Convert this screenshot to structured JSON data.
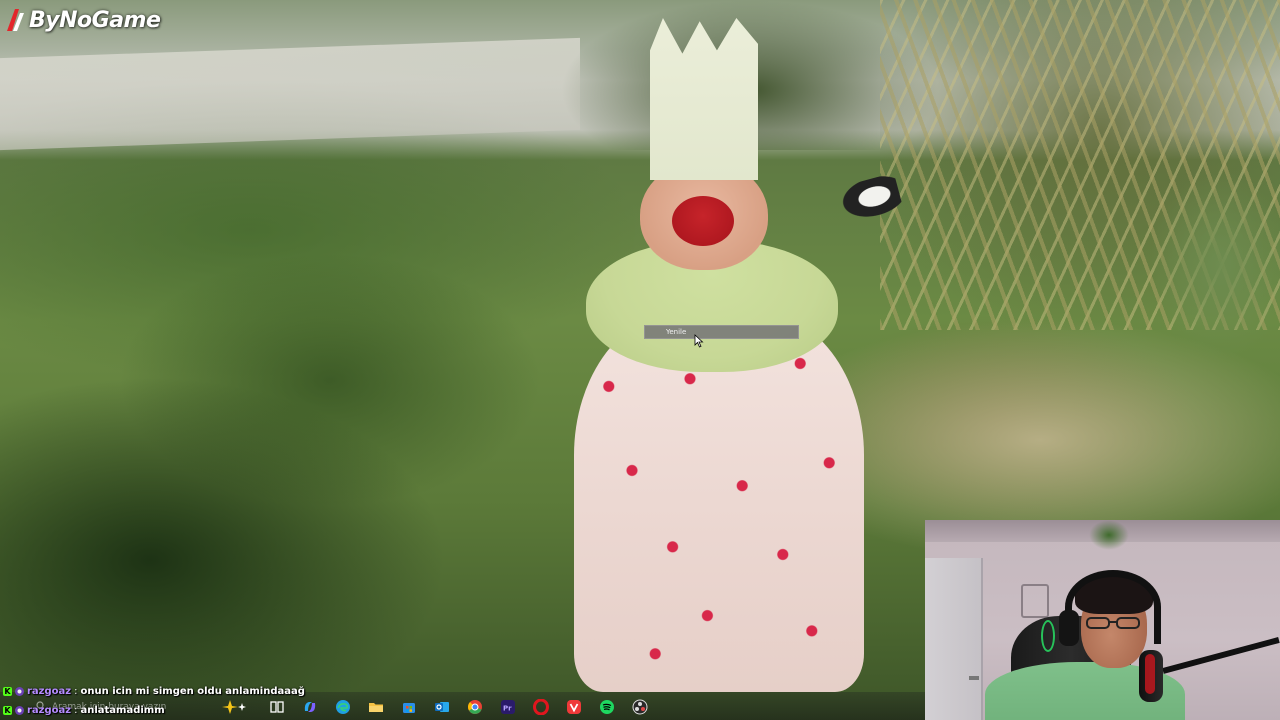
{
  "overlay": {
    "logo_text": "ByNoGame",
    "logo_icon": "bynogame-logo-icon"
  },
  "context_tooltip": {
    "label": "Yenile"
  },
  "chat": {
    "messages": [
      {
        "username": "razgoaz",
        "separator": ":",
        "message": "onun icin mi simgen oldu anlamindaaağ"
      },
      {
        "username": "razgoaz",
        "separator": ":",
        "message": "anlatamadimm"
      }
    ]
  },
  "taskbar": {
    "search_placeholder": "Aramak için buraya yazın",
    "apps": [
      {
        "name": "task-view-icon",
        "color": "#ffffff"
      },
      {
        "name": "copilot-icon",
        "color": "#7b61ff"
      },
      {
        "name": "edge-icon",
        "color": "#1fa0e3"
      },
      {
        "name": "file-explorer-icon",
        "color": "#f6c343"
      },
      {
        "name": "microsoft-store-icon",
        "color": "#2a8ee8"
      },
      {
        "name": "outlook-icon",
        "color": "#0f6cbd"
      },
      {
        "name": "chrome-icon",
        "color": "#e94235"
      },
      {
        "name": "premiere-pro-icon",
        "color": "#2a1b6a"
      },
      {
        "name": "opera-icon",
        "color": "#e0161e"
      },
      {
        "name": "vivaldi-icon",
        "color": "#ef3939"
      },
      {
        "name": "spotify-icon",
        "color": "#1ed760"
      },
      {
        "name": "obs-icon",
        "color": "#2a2a2a"
      }
    ]
  }
}
